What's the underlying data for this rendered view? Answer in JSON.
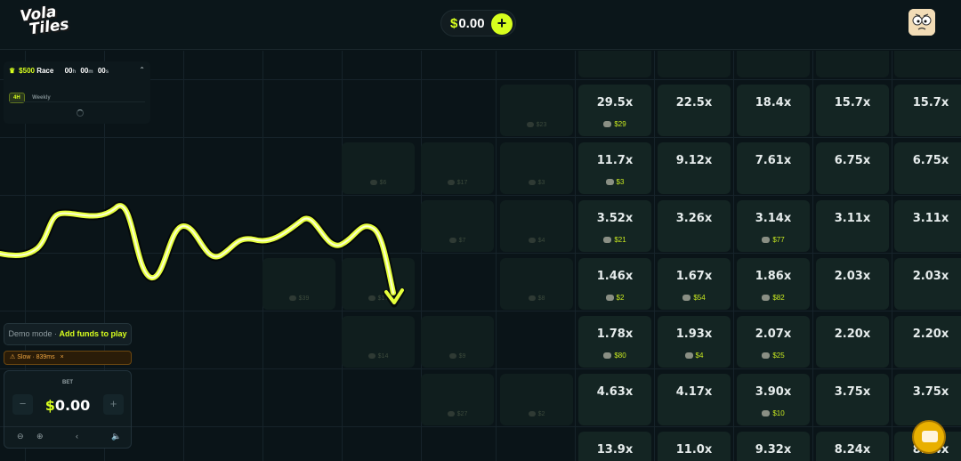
{
  "header": {
    "logo_line1": "Vola",
    "logo_line2": "Tiles",
    "balance_currency": "$",
    "balance_amount": "0.00",
    "add_funds_symbol": "+"
  },
  "race": {
    "prize": "$500",
    "title": "Race",
    "hours": "00",
    "hours_unit": "h",
    "minutes": "00",
    "minutes_unit": "m",
    "seconds": "00",
    "seconds_unit": "s",
    "tabs": [
      "4H",
      "Weekly"
    ],
    "active_tab": "4H"
  },
  "demo_banner": {
    "mode_text": "Demo mode",
    "separator": "·",
    "cta": "Add funds to play"
  },
  "latency": {
    "text": "Slow · 839ms",
    "close": "×"
  },
  "bet_panel": {
    "label": "BET",
    "currency": "$",
    "amount": "0.00",
    "minus": "−",
    "plus": "+"
  },
  "board": {
    "rows": [
      [
        "29.5x",
        "22.5x",
        "18.4x",
        "15.7x",
        "15.7x"
      ],
      [
        "11.7x",
        "9.12x",
        "7.61x",
        "6.75x",
        "6.75x"
      ],
      [
        "3.52x",
        "3.26x",
        "3.14x",
        "3.11x",
        "3.11x"
      ],
      [
        "1.46x",
        "1.67x",
        "1.86x",
        "2.03x",
        "2.03x"
      ],
      [
        "1.78x",
        "1.93x",
        "2.07x",
        "2.20x",
        "2.20x"
      ],
      [
        "4.63x",
        "4.17x",
        "3.90x",
        "3.75x",
        "3.75x"
      ],
      [
        "13.9x",
        "11.0x",
        "9.32x",
        "8.24x",
        "8.24x"
      ]
    ],
    "bets": [
      {
        "row": 0,
        "col": 0,
        "label": "$29"
      },
      {
        "row": 1,
        "col": 0,
        "label": "$3"
      },
      {
        "row": 2,
        "col": 0,
        "label": "$21"
      },
      {
        "row": 2,
        "col": 2,
        "label": "$77"
      },
      {
        "row": 3,
        "col": 0,
        "label": "$2"
      },
      {
        "row": 3,
        "col": 1,
        "label": "$54"
      },
      {
        "row": 3,
        "col": 2,
        "label": "$82"
      },
      {
        "row": 4,
        "col": 0,
        "label": "$80"
      },
      {
        "row": 4,
        "col": 1,
        "label": "$4"
      },
      {
        "row": 4,
        "col": 2,
        "label": "$25"
      },
      {
        "row": 5,
        "col": 2,
        "label": "$10"
      }
    ],
    "ghost_bets": [
      {
        "col": 6,
        "row": 1,
        "label": "$23"
      },
      {
        "col": 4,
        "row": 2,
        "label": "$6"
      },
      {
        "col": 5,
        "row": 2,
        "label": "$17"
      },
      {
        "col": 6,
        "row": 2,
        "label": "$3"
      },
      {
        "col": 5,
        "row": 3,
        "label": "$7"
      },
      {
        "col": 6,
        "row": 3,
        "label": "$4"
      },
      {
        "col": 3,
        "row": 4,
        "label": "$39"
      },
      {
        "col": 4,
        "row": 4,
        "label": "$17"
      },
      {
        "col": 6,
        "row": 4,
        "label": "$8"
      },
      {
        "col": 4,
        "row": 5,
        "label": "$14"
      },
      {
        "col": 5,
        "row": 5,
        "label": "$9"
      },
      {
        "col": 5,
        "row": 6,
        "label": "$27"
      },
      {
        "col": 6,
        "row": 6,
        "label": "$2"
      }
    ]
  },
  "colors": {
    "accent": "#d8ff1e",
    "background": "#0a1418",
    "tile": "#142523",
    "warning": "#f0a640"
  },
  "icons": {
    "trophy": "trophy-icon",
    "caret": "chevron-up-icon",
    "warning": "warning-icon",
    "zoom_out": "zoom-out-icon",
    "zoom_in": "zoom-in-icon",
    "back": "chevron-left-icon",
    "sound": "mute-icon",
    "chat": "chat-icon"
  }
}
